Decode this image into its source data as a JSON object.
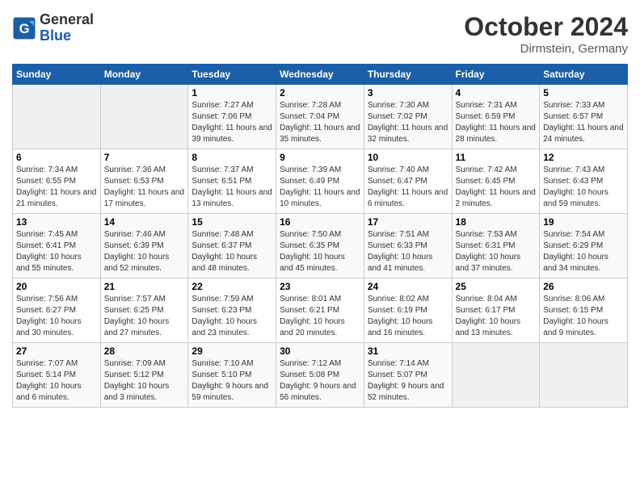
{
  "header": {
    "logo_text_general": "General",
    "logo_text_blue": "Blue",
    "month_year": "October 2024",
    "location": "Dirmstein, Germany"
  },
  "weekdays": [
    "Sunday",
    "Monday",
    "Tuesday",
    "Wednesday",
    "Thursday",
    "Friday",
    "Saturday"
  ],
  "weeks": [
    [
      {
        "day": "",
        "empty": true
      },
      {
        "day": "",
        "empty": true
      },
      {
        "day": "1",
        "sunrise": "Sunrise: 7:27 AM",
        "sunset": "Sunset: 7:06 PM",
        "daylight": "Daylight: 11 hours and 39 minutes."
      },
      {
        "day": "2",
        "sunrise": "Sunrise: 7:28 AM",
        "sunset": "Sunset: 7:04 PM",
        "daylight": "Daylight: 11 hours and 35 minutes."
      },
      {
        "day": "3",
        "sunrise": "Sunrise: 7:30 AM",
        "sunset": "Sunset: 7:02 PM",
        "daylight": "Daylight: 11 hours and 32 minutes."
      },
      {
        "day": "4",
        "sunrise": "Sunrise: 7:31 AM",
        "sunset": "Sunset: 6:59 PM",
        "daylight": "Daylight: 11 hours and 28 minutes."
      },
      {
        "day": "5",
        "sunrise": "Sunrise: 7:33 AM",
        "sunset": "Sunset: 6:57 PM",
        "daylight": "Daylight: 11 hours and 24 minutes."
      }
    ],
    [
      {
        "day": "6",
        "sunrise": "Sunrise: 7:34 AM",
        "sunset": "Sunset: 6:55 PM",
        "daylight": "Daylight: 11 hours and 21 minutes."
      },
      {
        "day": "7",
        "sunrise": "Sunrise: 7:36 AM",
        "sunset": "Sunset: 6:53 PM",
        "daylight": "Daylight: 11 hours and 17 minutes."
      },
      {
        "day": "8",
        "sunrise": "Sunrise: 7:37 AM",
        "sunset": "Sunset: 6:51 PM",
        "daylight": "Daylight: 11 hours and 13 minutes."
      },
      {
        "day": "9",
        "sunrise": "Sunrise: 7:39 AM",
        "sunset": "Sunset: 6:49 PM",
        "daylight": "Daylight: 11 hours and 10 minutes."
      },
      {
        "day": "10",
        "sunrise": "Sunrise: 7:40 AM",
        "sunset": "Sunset: 6:47 PM",
        "daylight": "Daylight: 11 hours and 6 minutes."
      },
      {
        "day": "11",
        "sunrise": "Sunrise: 7:42 AM",
        "sunset": "Sunset: 6:45 PM",
        "daylight": "Daylight: 11 hours and 2 minutes."
      },
      {
        "day": "12",
        "sunrise": "Sunrise: 7:43 AM",
        "sunset": "Sunset: 6:43 PM",
        "daylight": "Daylight: 10 hours and 59 minutes."
      }
    ],
    [
      {
        "day": "13",
        "sunrise": "Sunrise: 7:45 AM",
        "sunset": "Sunset: 6:41 PM",
        "daylight": "Daylight: 10 hours and 55 minutes."
      },
      {
        "day": "14",
        "sunrise": "Sunrise: 7:46 AM",
        "sunset": "Sunset: 6:39 PM",
        "daylight": "Daylight: 10 hours and 52 minutes."
      },
      {
        "day": "15",
        "sunrise": "Sunrise: 7:48 AM",
        "sunset": "Sunset: 6:37 PM",
        "daylight": "Daylight: 10 hours and 48 minutes."
      },
      {
        "day": "16",
        "sunrise": "Sunrise: 7:50 AM",
        "sunset": "Sunset: 6:35 PM",
        "daylight": "Daylight: 10 hours and 45 minutes."
      },
      {
        "day": "17",
        "sunrise": "Sunrise: 7:51 AM",
        "sunset": "Sunset: 6:33 PM",
        "daylight": "Daylight: 10 hours and 41 minutes."
      },
      {
        "day": "18",
        "sunrise": "Sunrise: 7:53 AM",
        "sunset": "Sunset: 6:31 PM",
        "daylight": "Daylight: 10 hours and 37 minutes."
      },
      {
        "day": "19",
        "sunrise": "Sunrise: 7:54 AM",
        "sunset": "Sunset: 6:29 PM",
        "daylight": "Daylight: 10 hours and 34 minutes."
      }
    ],
    [
      {
        "day": "20",
        "sunrise": "Sunrise: 7:56 AM",
        "sunset": "Sunset: 6:27 PM",
        "daylight": "Daylight: 10 hours and 30 minutes."
      },
      {
        "day": "21",
        "sunrise": "Sunrise: 7:57 AM",
        "sunset": "Sunset: 6:25 PM",
        "daylight": "Daylight: 10 hours and 27 minutes."
      },
      {
        "day": "22",
        "sunrise": "Sunrise: 7:59 AM",
        "sunset": "Sunset: 6:23 PM",
        "daylight": "Daylight: 10 hours and 23 minutes."
      },
      {
        "day": "23",
        "sunrise": "Sunrise: 8:01 AM",
        "sunset": "Sunset: 6:21 PM",
        "daylight": "Daylight: 10 hours and 20 minutes."
      },
      {
        "day": "24",
        "sunrise": "Sunrise: 8:02 AM",
        "sunset": "Sunset: 6:19 PM",
        "daylight": "Daylight: 10 hours and 16 minutes."
      },
      {
        "day": "25",
        "sunrise": "Sunrise: 8:04 AM",
        "sunset": "Sunset: 6:17 PM",
        "daylight": "Daylight: 10 hours and 13 minutes."
      },
      {
        "day": "26",
        "sunrise": "Sunrise: 8:06 AM",
        "sunset": "Sunset: 6:15 PM",
        "daylight": "Daylight: 10 hours and 9 minutes."
      }
    ],
    [
      {
        "day": "27",
        "sunrise": "Sunrise: 7:07 AM",
        "sunset": "Sunset: 5:14 PM",
        "daylight": "Daylight: 10 hours and 6 minutes."
      },
      {
        "day": "28",
        "sunrise": "Sunrise: 7:09 AM",
        "sunset": "Sunset: 5:12 PM",
        "daylight": "Daylight: 10 hours and 3 minutes."
      },
      {
        "day": "29",
        "sunrise": "Sunrise: 7:10 AM",
        "sunset": "Sunset: 5:10 PM",
        "daylight": "Daylight: 9 hours and 59 minutes."
      },
      {
        "day": "30",
        "sunrise": "Sunrise: 7:12 AM",
        "sunset": "Sunset: 5:08 PM",
        "daylight": "Daylight: 9 hours and 56 minutes."
      },
      {
        "day": "31",
        "sunrise": "Sunrise: 7:14 AM",
        "sunset": "Sunset: 5:07 PM",
        "daylight": "Daylight: 9 hours and 52 minutes."
      },
      {
        "day": "",
        "empty": true
      },
      {
        "day": "",
        "empty": true
      }
    ]
  ]
}
